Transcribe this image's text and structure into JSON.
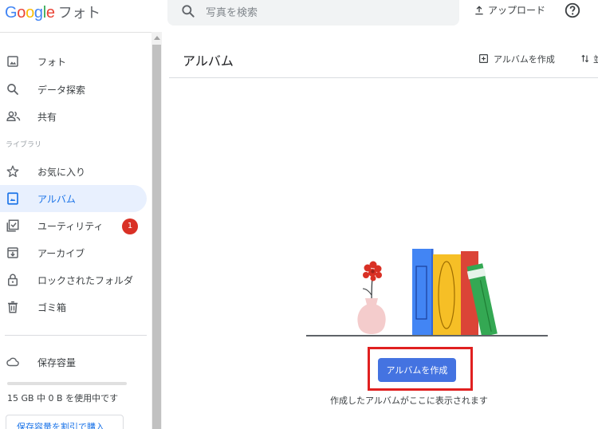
{
  "app": {
    "logo_word": "Google",
    "product_name": "フォト"
  },
  "search": {
    "placeholder": "写真を検索"
  },
  "header": {
    "upload_label": "アップロード"
  },
  "sidebar": {
    "items": [
      {
        "label": "フォト",
        "icon": "photo-icon"
      },
      {
        "label": "データ探索",
        "icon": "search-icon"
      },
      {
        "label": "共有",
        "icon": "people-icon"
      }
    ],
    "library_label": "ライブラリ",
    "library_items": [
      {
        "label": "お気に入り",
        "icon": "star-icon"
      },
      {
        "label": "アルバム",
        "icon": "album-icon",
        "active": true
      },
      {
        "label": "ユーティリティ",
        "icon": "checklist-icon",
        "badge": "1"
      },
      {
        "label": "アーカイブ",
        "icon": "archive-icon"
      },
      {
        "label": "ロックされたフォルダ",
        "icon": "lock-icon"
      },
      {
        "label": "ゴミ箱",
        "icon": "trash-icon"
      }
    ],
    "storage": {
      "label": "保存容量",
      "usage_text": "15 GB 中 0 B を使用中です",
      "used_fraction": 0,
      "buy_label": "保存容量を割引で購入"
    }
  },
  "main": {
    "title": "アルバム",
    "create_album_link": "アルバムを作成",
    "sort_label_partial": "並",
    "create_button": "アルバムを作成",
    "empty_message": "作成したアルバムがここに表示されます"
  },
  "colors": {
    "accent": "#1a73e8",
    "button": "#4473e1",
    "active_bg": "#e8f0fe",
    "highlight_border": "#e02020",
    "badge": "#d93025"
  }
}
